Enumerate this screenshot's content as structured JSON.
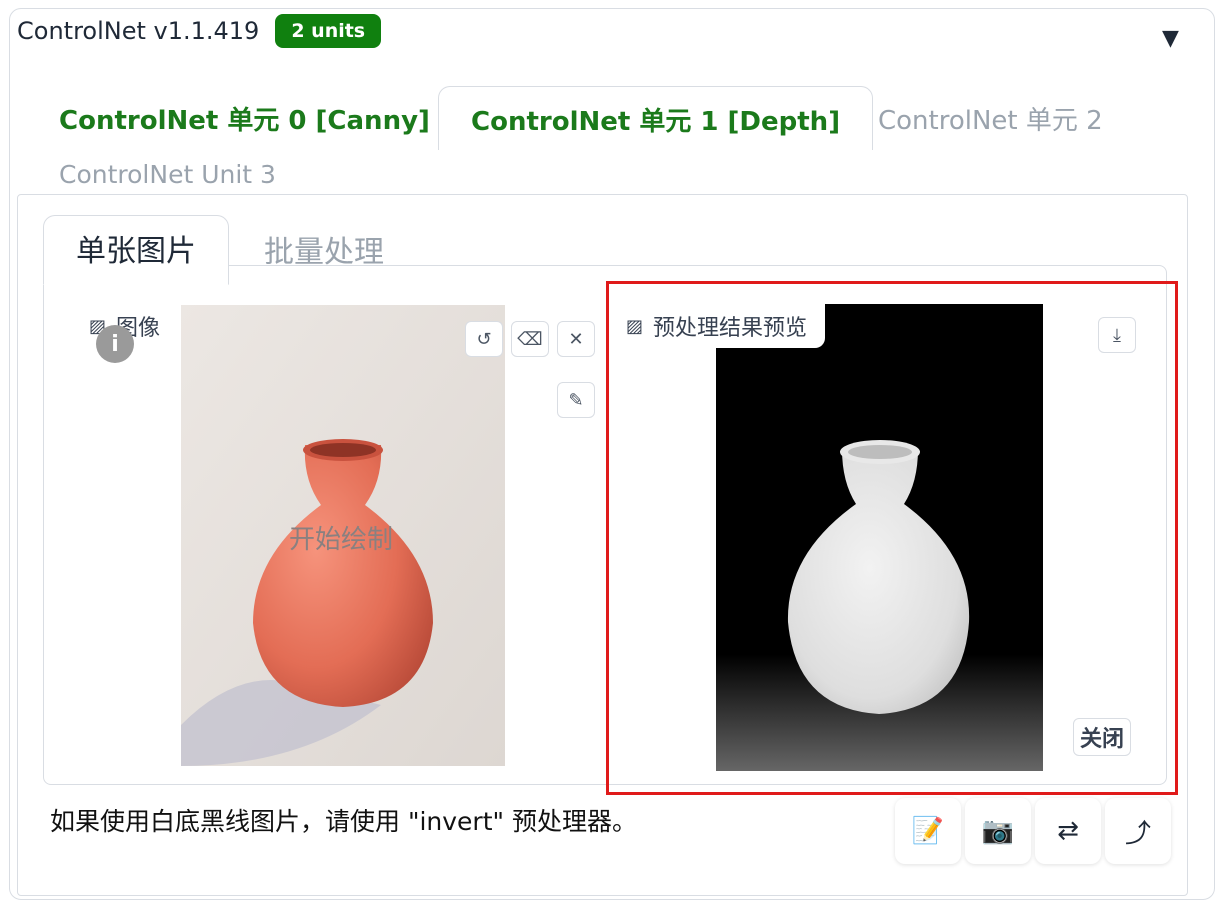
{
  "header": {
    "title": "ControlNet v1.1.419",
    "badge": "2 units",
    "collapse_icon": "▼"
  },
  "unit_tabs": [
    {
      "label": "ControlNet 单元 0 [Canny]",
      "state": "enabled"
    },
    {
      "label": "ControlNet 单元 1 [Depth]",
      "state": "selected"
    },
    {
      "label": "ControlNet 单元 2",
      "state": "inactive"
    },
    {
      "label": "ControlNet Unit 3",
      "state": "inactive"
    }
  ],
  "mode_tabs": [
    {
      "label": "单张图片",
      "state": "selected"
    },
    {
      "label": "批量处理",
      "state": "inactive"
    }
  ],
  "input_image": {
    "label": "图像",
    "overlay_text": "开始绘制",
    "buttons": [
      "undo-icon",
      "eraser-icon",
      "close-icon",
      "brush-icon"
    ]
  },
  "preview_image": {
    "label": "预处理结果预览",
    "close_button": "关闭",
    "buttons": [
      "download-icon"
    ]
  },
  "tip": "如果使用白底黑线图片，请使用 \"invert\" 预处理器。",
  "tools": [
    {
      "icon": "edit-icon",
      "glyph": "📝"
    },
    {
      "icon": "camera-icon",
      "glyph": "📷"
    },
    {
      "icon": "swap-icon",
      "glyph": "⇄"
    },
    {
      "icon": "send-icon",
      "glyph": "⤴"
    }
  ],
  "colors": {
    "accent_green": "#10800f",
    "highlight_red": "#e01a1a"
  }
}
